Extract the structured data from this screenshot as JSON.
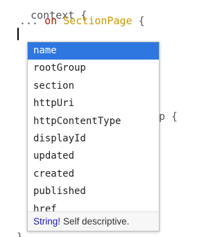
{
  "editor": {
    "line1": {
      "text": "context {"
    },
    "line2": {
      "ellipsis": "...",
      "keyword": "on",
      "type_name": "SectionPage",
      "brace": "{"
    },
    "bg_fragment": {
      "text": "p {"
    },
    "bottom_fragment": {
      "text": "}"
    }
  },
  "hint_list": {
    "items": [
      {
        "label": "name",
        "active": true
      },
      {
        "label": "rootGroup",
        "active": false
      },
      {
        "label": "section",
        "active": false
      },
      {
        "label": "httpUri",
        "active": false
      },
      {
        "label": "httpContentType",
        "active": false
      },
      {
        "label": "displayId",
        "active": false
      },
      {
        "label": "updated",
        "active": false
      },
      {
        "label": "created",
        "active": false
      },
      {
        "label": "published",
        "active": false
      },
      {
        "label": "href",
        "active": false
      }
    ],
    "info": {
      "type": "String!",
      "description": "Self descriptive."
    }
  },
  "colors": {
    "selection": "#2f77e0",
    "keyword": "#b11a04",
    "type_name": "#ca9800",
    "info_type": "#1a17bd"
  }
}
